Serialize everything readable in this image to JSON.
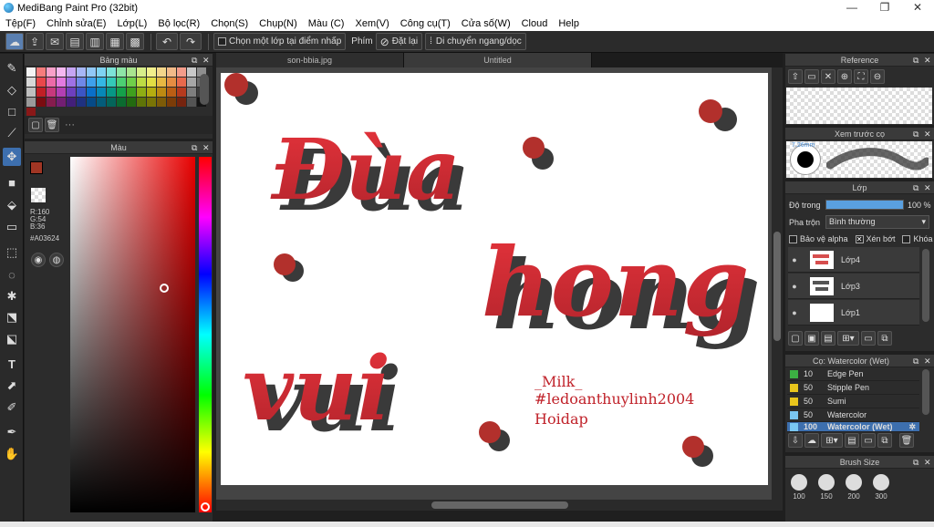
{
  "window": {
    "title": "MediBang Paint Pro (32bit)",
    "minimize": "—",
    "maximize": "❐",
    "close": "✕"
  },
  "menu": [
    "Tệp(F)",
    "Chỉnh sửa(E)",
    "Lớp(L)",
    "Bộ lọc(R)",
    "Chọn(S)",
    "Chụp(N)",
    "Màu (C)",
    "Xem(V)",
    "Công cụ(T)",
    "Cửa số(W)",
    "Cloud",
    "Help"
  ],
  "toolbar": {
    "pick_layer_label": "Chọn một lớp tại điểm nhấp",
    "key_label": "Phím",
    "reset_label": "Đặt lại",
    "move_label": "Di chuyển ngang/dọc"
  },
  "palette": {
    "title": "Bảng màu",
    "dots": "···",
    "colors": [
      "#f4f4f4",
      "#f77c7c",
      "#f9a0c9",
      "#f5b7f0",
      "#c6a5f3",
      "#a7b7f7",
      "#91c8f7",
      "#7fd3f2",
      "#7de3d8",
      "#8ee6a7",
      "#a9e58f",
      "#d7ee8a",
      "#f1ef8c",
      "#f3d68b",
      "#f2ba89",
      "#f39c8a",
      "#c9c9c9",
      "#8e8e8e",
      "#d8d8d8",
      "#e9474a",
      "#ec6aa8",
      "#e37ae0",
      "#9f71e5",
      "#6f88e8",
      "#3ea0ec",
      "#34b7e4",
      "#34c9b8",
      "#4ccf73",
      "#6fcf4a",
      "#bddb44",
      "#e2de44",
      "#e7b842",
      "#e68d42",
      "#e8694c",
      "#a7a7a7",
      "#6a6a6a",
      "#bfbfbf",
      "#c11f25",
      "#c7387c",
      "#b33fb3",
      "#6e3fbe",
      "#3c55c4",
      "#0a6fc9",
      "#0788b8",
      "#079786",
      "#14a14a",
      "#3fa01e",
      "#8fae14",
      "#b5ad10",
      "#bd8a12",
      "#bb5e14",
      "#b63a1e",
      "#7e7e7e",
      "#3e3e3e",
      "#9a9a9a",
      "#7a0c10",
      "#861c4e",
      "#731f73",
      "#431f7a",
      "#1f3180",
      "#064a87",
      "#045c7a",
      "#04655a",
      "#0b6b30",
      "#236a10",
      "#5f7408",
      "#797406",
      "#7d5b08",
      "#7b3c08",
      "#76240f",
      "#545454",
      "#141414",
      "#8a1818"
    ]
  },
  "color_panel": {
    "title": "Màu",
    "fg": "#A03624",
    "r": "R:160",
    "g": "G:54",
    "b": "B:36",
    "hex": "#A03624",
    "sv_fraction": [
      0.75,
      0.37
    ],
    "hue_fraction": 1.0
  },
  "tabs": [
    "son-bbia.jpg",
    "Untitled"
  ],
  "canvas": {
    "words": [
      "Đùa",
      "hong",
      "vui"
    ],
    "credit_lines": [
      "_Milk_",
      "#ledoanthuylinh2004",
      "Hoidap"
    ]
  },
  "reference": {
    "title": "Reference"
  },
  "brush_preview": {
    "title": "Xem trước cọ",
    "size_label": "7.26mm"
  },
  "layers": {
    "title": "Lớp",
    "opacity_label": "Độ trong",
    "opacity_value": "100 %",
    "opacity_fraction": 1.0,
    "blend_label": "Pha trộn",
    "blend_value": "Bình thường",
    "protect_alpha": "Bảo vệ alpha",
    "clipping": "Xén bớt",
    "lock": "Khóa",
    "items": [
      {
        "name": "Lớp4"
      },
      {
        "name": "Lớp3"
      },
      {
        "name": "Lớp1"
      }
    ]
  },
  "brushes": {
    "title": "Cọ: Watercolor (Wet)",
    "items": [
      {
        "size": "10",
        "name": "Edge Pen",
        "color": "#3cb043"
      },
      {
        "size": "50",
        "name": "Stipple Pen",
        "color": "#e8c51c"
      },
      {
        "size": "50",
        "name": "Sumi",
        "color": "#e8c51c"
      },
      {
        "size": "50",
        "name": "Watercolor",
        "color": "#7ac7f2"
      },
      {
        "size": "100",
        "name": "Watercolor (Wet)",
        "color": "#7ac7f2"
      }
    ]
  },
  "brush_size": {
    "title": "Brush Size",
    "sizes": [
      "100",
      "150",
      "200",
      "300"
    ]
  }
}
